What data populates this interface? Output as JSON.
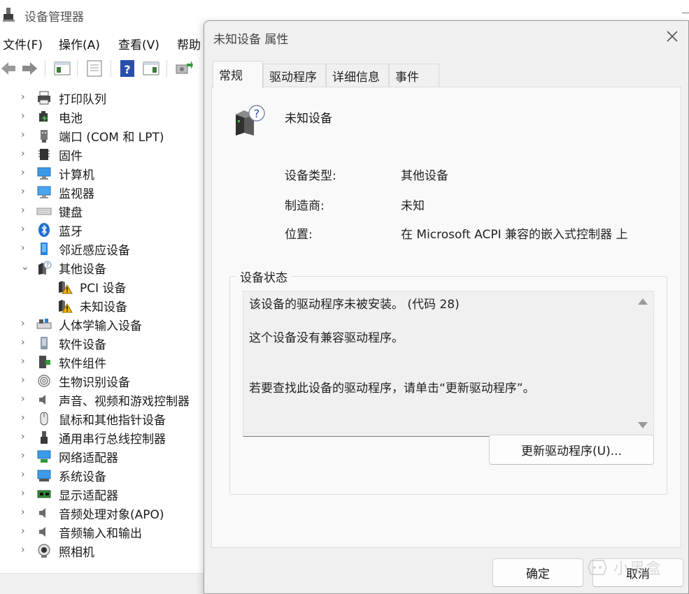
{
  "device_manager": {
    "title": "设备管理器",
    "menu": [
      "文件(F)",
      "操作(A)",
      "查看(V)",
      "帮助"
    ],
    "tree": [
      {
        "label": "打印队列",
        "icon": "printer-icon",
        "expanded": false
      },
      {
        "label": "电池",
        "icon": "battery-icon",
        "expanded": false
      },
      {
        "label": "端口 (COM 和 LPT)",
        "icon": "port-icon",
        "expanded": false
      },
      {
        "label": "固件",
        "icon": "firmware-chip-icon",
        "expanded": false
      },
      {
        "label": "计算机",
        "icon": "computer-icon",
        "expanded": false
      },
      {
        "label": "监视器",
        "icon": "monitor-icon",
        "expanded": false
      },
      {
        "label": "键盘",
        "icon": "keyboard-icon",
        "expanded": false
      },
      {
        "label": "蓝牙",
        "icon": "bluetooth-icon",
        "expanded": false
      },
      {
        "label": "邻近感应设备",
        "icon": "proximity-device-icon",
        "expanded": false
      },
      {
        "label": "其他设备",
        "icon": "unknown-device-icon",
        "expanded": true
      },
      {
        "label": "PCI 设备",
        "icon": "warning-device-icon",
        "child": true
      },
      {
        "label": "未知设备",
        "icon": "warning-device-icon",
        "child": true
      },
      {
        "label": "人体学输入设备",
        "icon": "hid-icon",
        "expanded": false
      },
      {
        "label": "软件设备",
        "icon": "software-device-icon",
        "expanded": false
      },
      {
        "label": "软件组件",
        "icon": "software-component-icon",
        "expanded": false
      },
      {
        "label": "生物识别设备",
        "icon": "fingerprint-icon",
        "expanded": false
      },
      {
        "label": "声音、视频和游戏控制器",
        "icon": "speaker-icon",
        "expanded": false
      },
      {
        "label": "鼠标和其他指针设备",
        "icon": "mouse-icon",
        "expanded": false
      },
      {
        "label": "通用串行总线控制器",
        "icon": "usb-icon",
        "expanded": false
      },
      {
        "label": "网络适配器",
        "icon": "network-adapter-icon",
        "expanded": false
      },
      {
        "label": "系统设备",
        "icon": "system-device-icon",
        "expanded": false
      },
      {
        "label": "显示适配器",
        "icon": "display-adapter-icon",
        "expanded": false
      },
      {
        "label": "音频处理对象(APO)",
        "icon": "speaker-icon",
        "expanded": false
      },
      {
        "label": "音频输入和输出",
        "icon": "speaker-icon",
        "expanded": false
      },
      {
        "label": "照相机",
        "icon": "camera-icon",
        "expanded": false
      }
    ]
  },
  "dialog": {
    "title": "未知设备 属性",
    "tabs": [
      "常规",
      "驱动程序",
      "详细信息",
      "事件"
    ],
    "active_tab": "常规",
    "device_name": "未知设备",
    "properties": [
      {
        "label": "设备类型:",
        "value": "其他设备"
      },
      {
        "label": "制造商:",
        "value": "未知"
      },
      {
        "label": "位置:",
        "value": "在 Microsoft ACPI 兼容的嵌入式控制器 上"
      }
    ],
    "status_title": "设备状态",
    "status_lines": [
      "该设备的驱动程序未被安装。 (代码 28)",
      "这个设备没有兼容驱动程序。",
      "若要查找此设备的驱动程序，请单击“更新驱动程序”。"
    ],
    "update_button": "更新驱动程序(U)...",
    "ok_button": "确定",
    "cancel_button": "取消"
  },
  "watermark": {
    "text": "小黑盒"
  },
  "colors": {
    "dialog_bg": "#f0f0f0",
    "panel_bg": "#f9f9f9",
    "warning": "#f2b400",
    "bluetooth": "#1f6fd0"
  }
}
